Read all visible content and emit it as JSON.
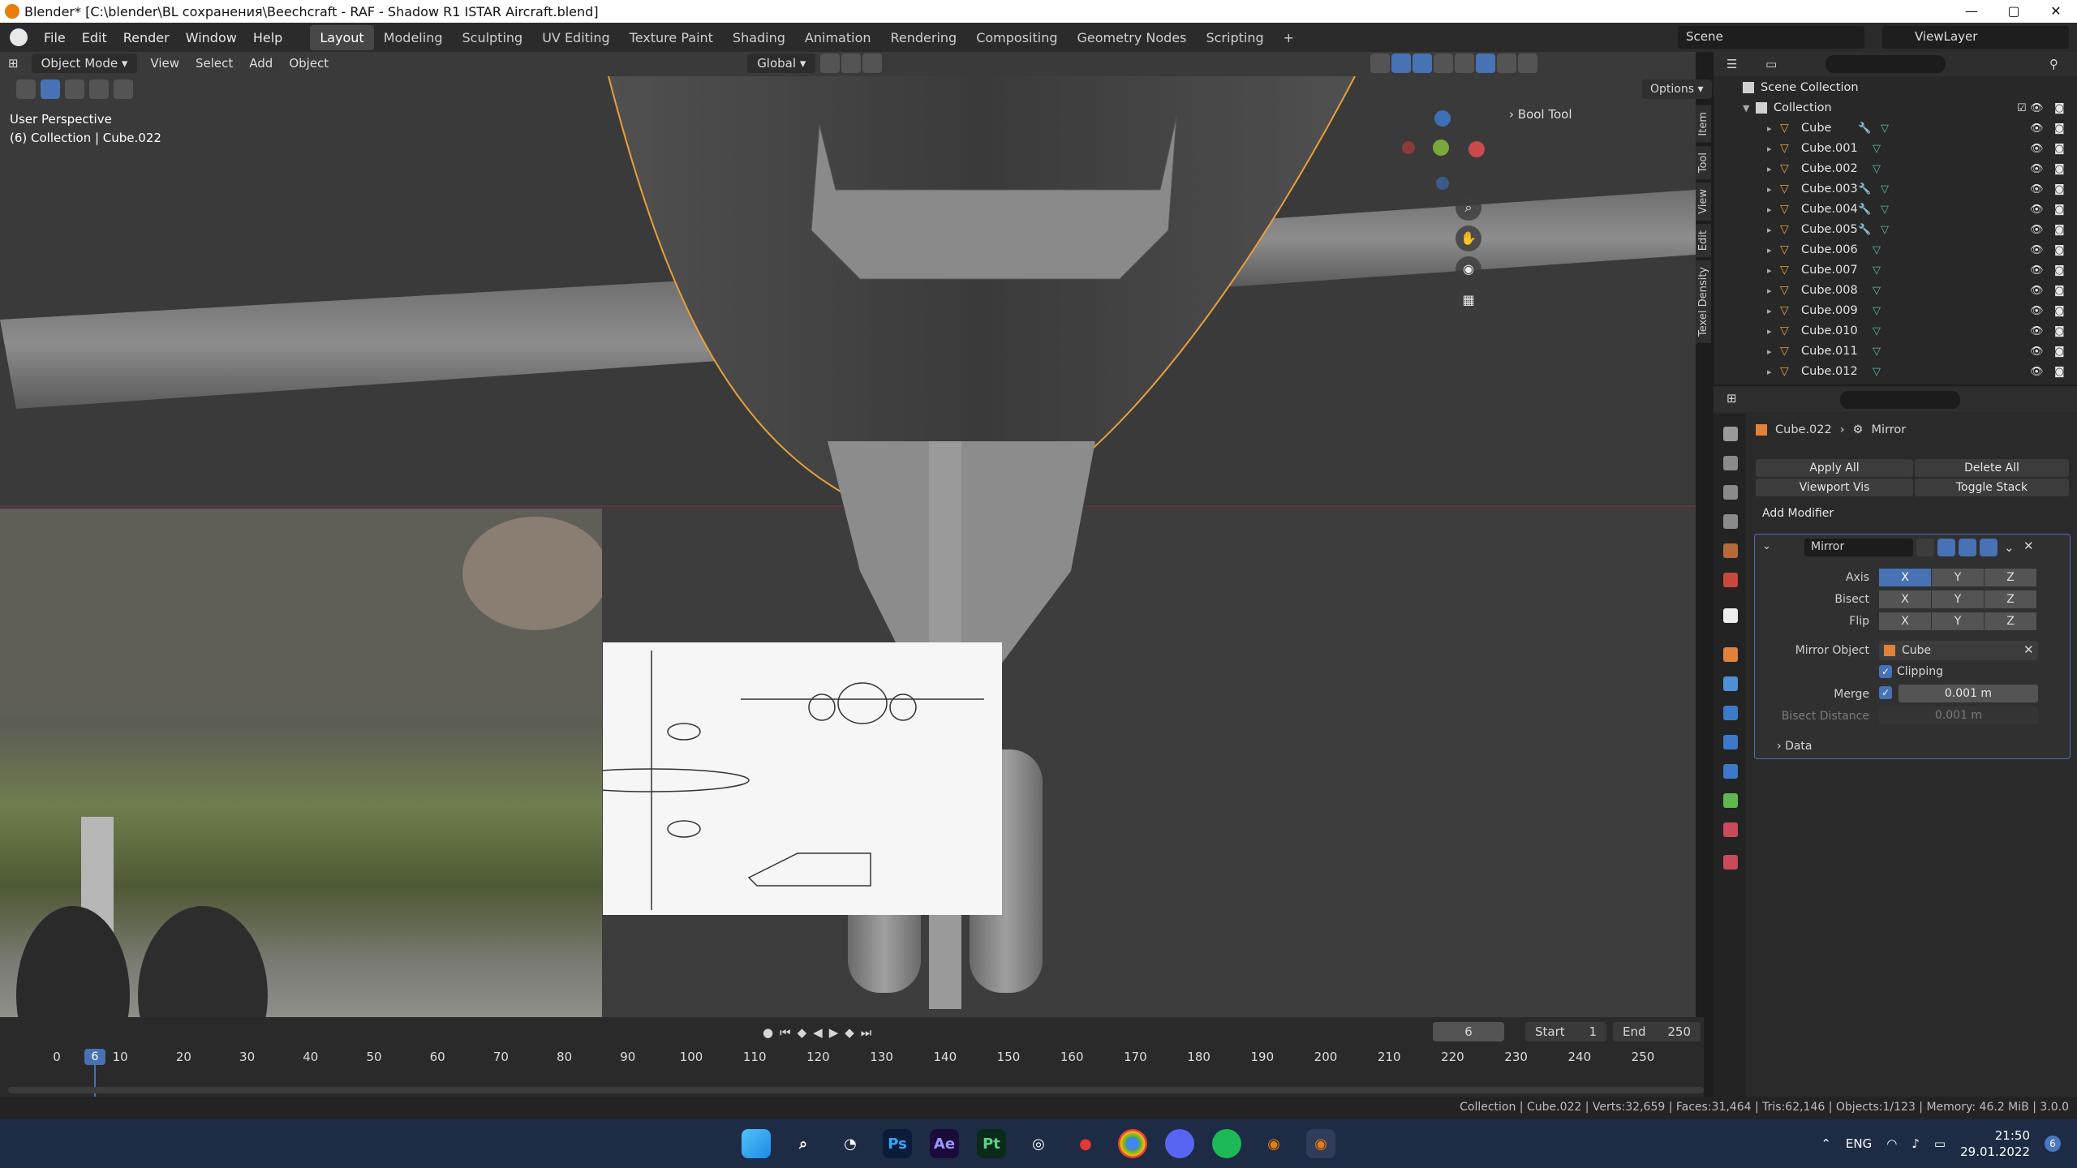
{
  "window": {
    "title": "Blender* [C:\\blender\\BL сохранения\\Beechcraft - RAF - Shadow R1 ISTAR Aircraft.blend]",
    "minimize": "—",
    "maximize": "▢",
    "close": "✕"
  },
  "menu": [
    "File",
    "Edit",
    "Render",
    "Window",
    "Help"
  ],
  "workspaces": [
    {
      "label": "Layout",
      "active": true
    },
    {
      "label": "Modeling"
    },
    {
      "label": "Sculpting"
    },
    {
      "label": "UV Editing"
    },
    {
      "label": "Texture Paint"
    },
    {
      "label": "Shading"
    },
    {
      "label": "Animation"
    },
    {
      "label": "Rendering"
    },
    {
      "label": "Compositing"
    },
    {
      "label": "Geometry Nodes"
    },
    {
      "label": "Scripting"
    },
    {
      "label": "+"
    }
  ],
  "scene": {
    "label": "Scene"
  },
  "viewlayer": {
    "label": "ViewLayer"
  },
  "viewport": {
    "mode": "Object Mode",
    "menus": [
      "View",
      "Select",
      "Add",
      "Object"
    ],
    "orientation": "Global",
    "options": "Options",
    "perspective": "User Perspective",
    "collection_info": "(6) Collection | Cube.022",
    "bool_tool": "Bool Tool",
    "tabs": [
      "Item",
      "Tool",
      "View",
      "Edit",
      "Texel Density"
    ],
    "gizmo": {
      "z": "Z",
      "x": "X",
      "y": "Y"
    }
  },
  "timeline": {
    "current_frame": "6",
    "start_label": "Start",
    "start": "1",
    "end_label": "End",
    "end": "250",
    "ticks": [
      "0",
      "10",
      "20",
      "30",
      "40",
      "50",
      "60",
      "70",
      "80",
      "90",
      "100",
      "110",
      "120",
      "130",
      "140",
      "150",
      "160",
      "170",
      "180",
      "190",
      "200",
      "210",
      "220",
      "230",
      "240",
      "250"
    ]
  },
  "status": "Collection | Cube.022 | Verts:32,659 | Faces:31,464 | Tris:62,146 | Objects:1/123 | Memory: 46.2 MiB | 3.0.0",
  "outliner": {
    "scene_collection": "Scene Collection",
    "collection": "Collection",
    "items": [
      {
        "name": "Cube",
        "wrench": true
      },
      {
        "name": "Cube.001",
        "wrench": false
      },
      {
        "name": "Cube.002",
        "wrench": false
      },
      {
        "name": "Cube.003",
        "wrench": true
      },
      {
        "name": "Cube.004",
        "wrench": true
      },
      {
        "name": "Cube.005",
        "wrench": true
      },
      {
        "name": "Cube.006",
        "wrench": false
      },
      {
        "name": "Cube.007",
        "wrench": false
      },
      {
        "name": "Cube.008",
        "wrench": false
      },
      {
        "name": "Cube.009",
        "wrench": false
      },
      {
        "name": "Cube.010",
        "wrench": false
      },
      {
        "name": "Cube.011",
        "wrench": false
      },
      {
        "name": "Cube.012",
        "wrench": false
      }
    ]
  },
  "properties": {
    "object": "Cube.022",
    "modifier_tab": "Mirror",
    "apply_all": "Apply All",
    "delete_all": "Delete All",
    "viewport_vis": "Viewport Vis",
    "toggle_stack": "Toggle Stack",
    "add_modifier": "Add Modifier",
    "modifier_name": "Mirror",
    "axis_label": "Axis",
    "bisect_label": "Bisect",
    "flip_label": "Flip",
    "axes": [
      "X",
      "Y",
      "Z"
    ],
    "mirror_object_label": "Mirror Object",
    "mirror_object": "Cube",
    "clipping": "Clipping",
    "merge_label": "Merge",
    "merge_value": "0.001 m",
    "bisect_distance_label": "Bisect Distance",
    "bisect_distance": "0.001 m",
    "data": "Data"
  },
  "taskbar": {
    "apps": [
      {
        "name": "Ps"
      },
      {
        "name": "Ae"
      },
      {
        "name": "Pt"
      }
    ],
    "lang": "ENG",
    "time": "21:50",
    "date": "29.01.2022",
    "badge": "6"
  },
  "colors": {
    "accent": "#4772b3",
    "selection": "#e8a03a",
    "brand": "#e87d0d"
  }
}
